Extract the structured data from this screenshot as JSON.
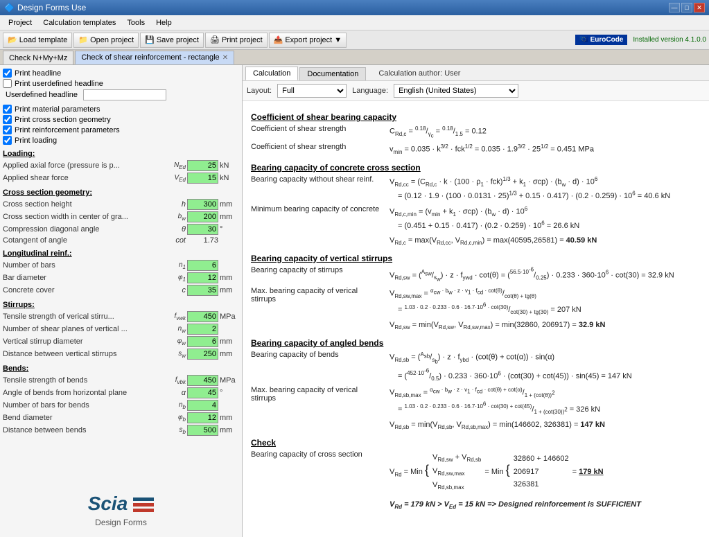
{
  "app": {
    "title": "Design Forms Use",
    "icon": "df-icon"
  },
  "window_controls": {
    "minimize": "—",
    "maximize": "□",
    "close": "✕"
  },
  "menu": {
    "items": [
      "Project",
      "Calculation templates",
      "Tools",
      "Help"
    ]
  },
  "toolbar": {
    "buttons": [
      {
        "id": "load-template",
        "icon": "📂",
        "label": "Load template"
      },
      {
        "id": "open-project",
        "icon": "📁",
        "label": "Open project"
      },
      {
        "id": "save-project",
        "icon": "💾",
        "label": "Save project"
      },
      {
        "id": "print-project",
        "icon": "🖨",
        "label": "Print project"
      },
      {
        "id": "export-project",
        "icon": "📤",
        "label": "Export project ▼"
      }
    ],
    "eurocode": "EuroCode",
    "installed": "Installed version 4.1.0.0"
  },
  "tabs": [
    {
      "id": "tab1",
      "label": "Check N+My+Mz",
      "active": false,
      "closeable": false
    },
    {
      "id": "tab2",
      "label": "Check of shear reinforcement - rectangle",
      "active": true,
      "closeable": true
    }
  ],
  "left_panel": {
    "checkboxes": [
      {
        "id": "print-headline",
        "label": "Print headline",
        "checked": true
      },
      {
        "id": "print-user-headline",
        "label": "Print userdefined headline",
        "checked": false
      }
    ],
    "headline_label": "Userdefined headline",
    "sections": [
      {
        "id": "print-options",
        "items": [
          {
            "id": "print-material",
            "label": "Print material parameters",
            "checked": true
          },
          {
            "id": "print-cross-section",
            "label": "Print cross section geometry",
            "checked": true
          },
          {
            "id": "print-reinforcement",
            "label": "Print reinforcement parameters",
            "checked": true
          },
          {
            "id": "print-loading",
            "label": "Print loading",
            "checked": true
          }
        ]
      },
      {
        "id": "loading",
        "title": "Loading:",
        "params": [
          {
            "label": "Applied axial force (pressure is p...",
            "symbol": "N_Ed",
            "value": "25",
            "unit": "kN",
            "has_input": true
          },
          {
            "label": "Applied shear force",
            "symbol": "V_Ed",
            "value": "15",
            "unit": "kN",
            "has_input": true
          }
        ]
      },
      {
        "id": "cross-section",
        "title": "Cross section geometry:",
        "params": [
          {
            "label": "Cross section height",
            "symbol": "h",
            "value": "300",
            "unit": "mm",
            "has_input": true
          },
          {
            "label": "Cross section width in center of gra...",
            "symbol": "b_w",
            "value": "200",
            "unit": "mm",
            "has_input": true
          },
          {
            "label": "Compression diagonal angle",
            "symbol": "θ",
            "value": "30",
            "unit": "°",
            "has_input": true
          },
          {
            "label": "Cotangent of angle",
            "symbol": "cot",
            "value": "1.73",
            "unit": "",
            "has_input": false
          }
        ]
      },
      {
        "id": "longitudinal-reinf",
        "title": "Longitudinal reinf.:",
        "params": [
          {
            "label": "Number of bars",
            "symbol": "n₁",
            "value": "6",
            "unit": "",
            "has_input": true
          },
          {
            "label": "Bar diameter",
            "symbol": "φ₁",
            "value": "12",
            "unit": "mm",
            "has_input": true
          },
          {
            "label": "Concrete cover",
            "symbol": "c",
            "value": "35",
            "unit": "mm",
            "has_input": true
          }
        ]
      },
      {
        "id": "stirrups",
        "title": "Stirrups:",
        "params": [
          {
            "label": "Tensile strength of verical stirru...",
            "symbol": "f_vwk",
            "value": "450",
            "unit": "MPa",
            "has_input": true
          },
          {
            "label": "Number of shear planes of vertical ...",
            "symbol": "n_w",
            "value": "2",
            "unit": "",
            "has_input": true
          },
          {
            "label": "Vertical stirrup diameter",
            "symbol": "φ_w",
            "value": "6",
            "unit": "mm",
            "has_input": true
          },
          {
            "label": "Distance between vertical stirrups",
            "symbol": "s_w",
            "value": "250",
            "unit": "mm",
            "has_input": true
          }
        ]
      },
      {
        "id": "bends",
        "title": "Bends:",
        "params": [
          {
            "label": "Tensile strength of bends",
            "symbol": "f_vbk",
            "value": "450",
            "unit": "MPa",
            "has_input": true
          },
          {
            "label": "Angle of bends from horizontal plane",
            "symbol": "α",
            "value": "45",
            "unit": "°",
            "has_input": true
          },
          {
            "label": "Number of bars for bends",
            "symbol": "n_b",
            "value": "4",
            "unit": "",
            "has_input": true
          },
          {
            "label": "Bend diameter",
            "symbol": "φ_b",
            "value": "12",
            "unit": "mm",
            "has_input": true
          },
          {
            "label": "Distance between bends",
            "symbol": "s_b",
            "value": "500",
            "unit": "mm",
            "has_input": true
          }
        ]
      }
    ],
    "logo": {
      "name": "Scia",
      "subtitle": "Design Forms"
    }
  },
  "right_panel": {
    "tabs": [
      {
        "id": "calc-tab",
        "label": "Calculation",
        "active": true
      },
      {
        "id": "doc-tab",
        "label": "Documentation",
        "active": false
      }
    ],
    "author": "Calculation author: User",
    "layout_label": "Layout:",
    "layout_value": "Full",
    "language_label": "Language:",
    "language_value": "English (United States)",
    "content": {
      "sections": [
        {
          "title": "Coefficient of shear bearing capacity",
          "rows": [
            {
              "label": "Coefficient of shear strength",
              "formula": "C_Rd,c = 0.18/γc = 0.18/1.5 = 0.12"
            },
            {
              "label": "Coefficient of shear strength",
              "formula": "v_min = 0.035 · k^(3/2) · fck^(1/2) = 0.035 · 1.9^(3/2) · 25^(1/2) = 0.451 MPa"
            }
          ]
        },
        {
          "title": "Bearing capacity of concrete cross section",
          "rows": [
            {
              "label": "Bearing capacity without shear reinf.",
              "formula": "V_Rd,cc = (C_Rd,c · k · (100 · ρ₁ · fck)^(1/3) + k₁ · σcp) · (b_w · d) · 10⁶\n= (0.12 · 1.9 · (100 · 0.0131 · 25)^(1/3) + 0.15 · 0.417) · (0.2 · 0.259) · 10⁶ = 40.6 kN"
            },
            {
              "label": "Minimum bearing capacity of concrete",
              "formula": "V_Rd,c,min = (v_min + k₁ · σcp) · (b_w · d) · 10⁶\n= (0.451 + 0.15 · 0.417) · (0.2 · 0.259) · 10⁶ = 26.6 kN"
            },
            {
              "label": "",
              "formula": "V_Rd,c = max(V_Rd,cc, V_Rd,c,min) = max(40595,26581) = 40.59 kN"
            }
          ]
        },
        {
          "title": "Bearing capacity of vertical stirrups",
          "rows": [
            {
              "label": "Bearing capacity of stirrups",
              "formula": "V_Rd,sw = (A_sw/s_w) · z · f_ywd · cot(θ) = (56.5·10⁻⁶/0.25) · 0.233 · 360·10⁶ · cot(30) = 32.9 kN"
            },
            {
              "label": "Max. bearing capacity of verical stirrups",
              "formula": "V_Rd,sw,max = (α_cw · b_w · z · v₁ · f_cd · cot(θ)) / (cot(θ) + tg(θ))\n= (1.03 · 0.2 · 0.233 · 0.6 · 16.7·10⁶ · cot(30)) / (cot(30) + tg(30)) = 207 kN"
            },
            {
              "label": "",
              "formula": "V_Rd,sw = min(V_Rd,sw, V_Rd,sw,max) = min(32860, 206917) = 32.9 kN"
            }
          ]
        },
        {
          "title": "Bearing capacity of angled bends",
          "rows": [
            {
              "label": "Bearing capacity of bends",
              "formula": "V_Rd,sb = (A_sb/s_b) · z · f_ybd · (cot(θ) + cot(α)) · sin(α)\n= (452·10⁻⁶/0.5) · 0.233 · 360·10⁶ · (cot(30) + cot(45)) · sin(45) = 147 kN"
            },
            {
              "label": "Max. bearing capacity of verical stirrups",
              "formula": "V_Rd,sb,max = (α_cw · b_w · z · v₁ · f_cd · cot(θ) + cot(α)) / (1 + (cot(θ))²)\n= (1.03 · 0.2 · 0.233 · 0.6 · 16.7·10⁶ · cot(30) + cot(45)) / (1 + (cot(30))²) = 326 kN"
            },
            {
              "label": "",
              "formula": "V_Rd,sb = min(V_Rd,sb, V_Rd,sb,max) = min(146602, 326381) = 147 kN"
            }
          ]
        },
        {
          "title": "Check",
          "rows": [
            {
              "label": "Bearing capacity of cross section",
              "formula": "V_Rd = Min{ V_Rd,sw + V_Rd,sb ; V_Rd,sw,max ; V_Rd,sb,max } = Min{ 32860 + 146602 ; 206917 ; 326381 } = 179 kN"
            },
            {
              "label": "",
              "formula": "V_Rd = 179  kN > V_Ed = 15  kN => Designed reinforcement is SUFFICIENT"
            }
          ]
        }
      ]
    }
  }
}
